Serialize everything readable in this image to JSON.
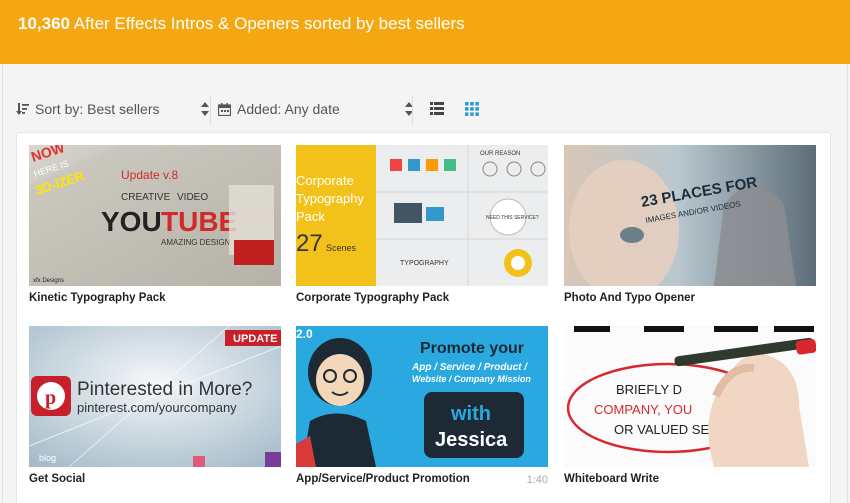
{
  "header": {
    "count": "10,360",
    "title_rest": "After Effects Intros & Openers sorted by best sellers"
  },
  "toolbar": {
    "sort_label": "Sort by: Best sellers",
    "added_label": "Added: Any date"
  },
  "colors": {
    "brand": "#f5a712",
    "accent_blue": "#2b9ad0"
  },
  "items": [
    {
      "title": "Kinetic Typography Pack",
      "thumb_lines": [
        "NOW",
        "HERE IS",
        "3D-IZER",
        "Update v.8",
        "YOU",
        "TUBE",
        "CREATIVE",
        "VIDEO",
        "AMAZING DESIGN",
        "xfx Designs"
      ]
    },
    {
      "title": "Corporate Typography Pack",
      "thumb_lines": [
        "Corporate",
        "Typography",
        "Pack",
        "27",
        "Scenes",
        "OUR REASON",
        "NEED THIS SERVICE?",
        "TYPOGRAPHY"
      ]
    },
    {
      "title": "Photo And Typo Opener",
      "thumb_lines": [
        "23 PLACES FOR",
        "IMAGES AND/OR VIDEOS"
      ]
    },
    {
      "title": "Get Social",
      "thumb_lines": [
        "UPDATE",
        "Pinterested in More?",
        "pinterest.com/yourcompany",
        "blog"
      ]
    },
    {
      "title": "App/Service/Product Promotion",
      "duration": "1:40",
      "thumb_lines": [
        "2.0",
        "Promote your",
        "App / Service / Product /",
        "Website / Company Mission",
        "with",
        "Jessica"
      ]
    },
    {
      "title": "Whiteboard Write",
      "thumb_lines": [
        "BRIEFLY D",
        "COMPANY, YOU",
        "OR VALUED SE"
      ]
    }
  ]
}
